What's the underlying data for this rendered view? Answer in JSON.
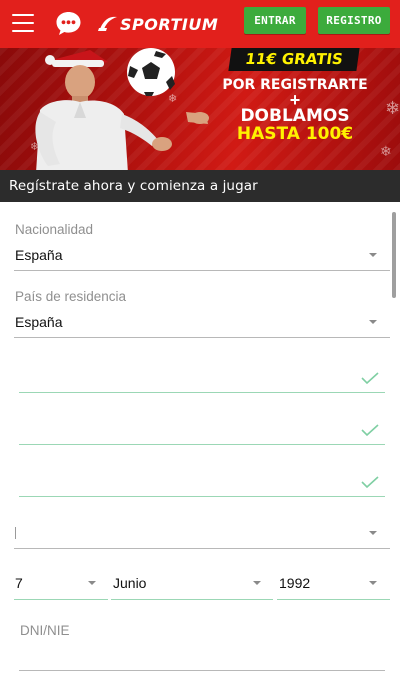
{
  "header": {
    "brand": "SPORTIUM",
    "login_label": "ENTRAR",
    "register_label": "REGISTRO",
    "accent_color": "#e2201c",
    "button_color": "#3cab3c"
  },
  "banner": {
    "line1": "11€ GRATIS",
    "line2": "POR REGISTRARTE",
    "plus": "+",
    "line3": "DOBLAMOS",
    "line4": "HASTA 100€"
  },
  "caption": "Regístrate ahora y comienza a jugar",
  "form": {
    "nationality": {
      "label": "Nacionalidad",
      "value": "España"
    },
    "residence": {
      "label": "País de residencia",
      "value": "España"
    },
    "birth": {
      "day": "7",
      "month": "Junio",
      "year": "1992"
    },
    "dni": {
      "placeholder": "DNI/NIE"
    }
  }
}
